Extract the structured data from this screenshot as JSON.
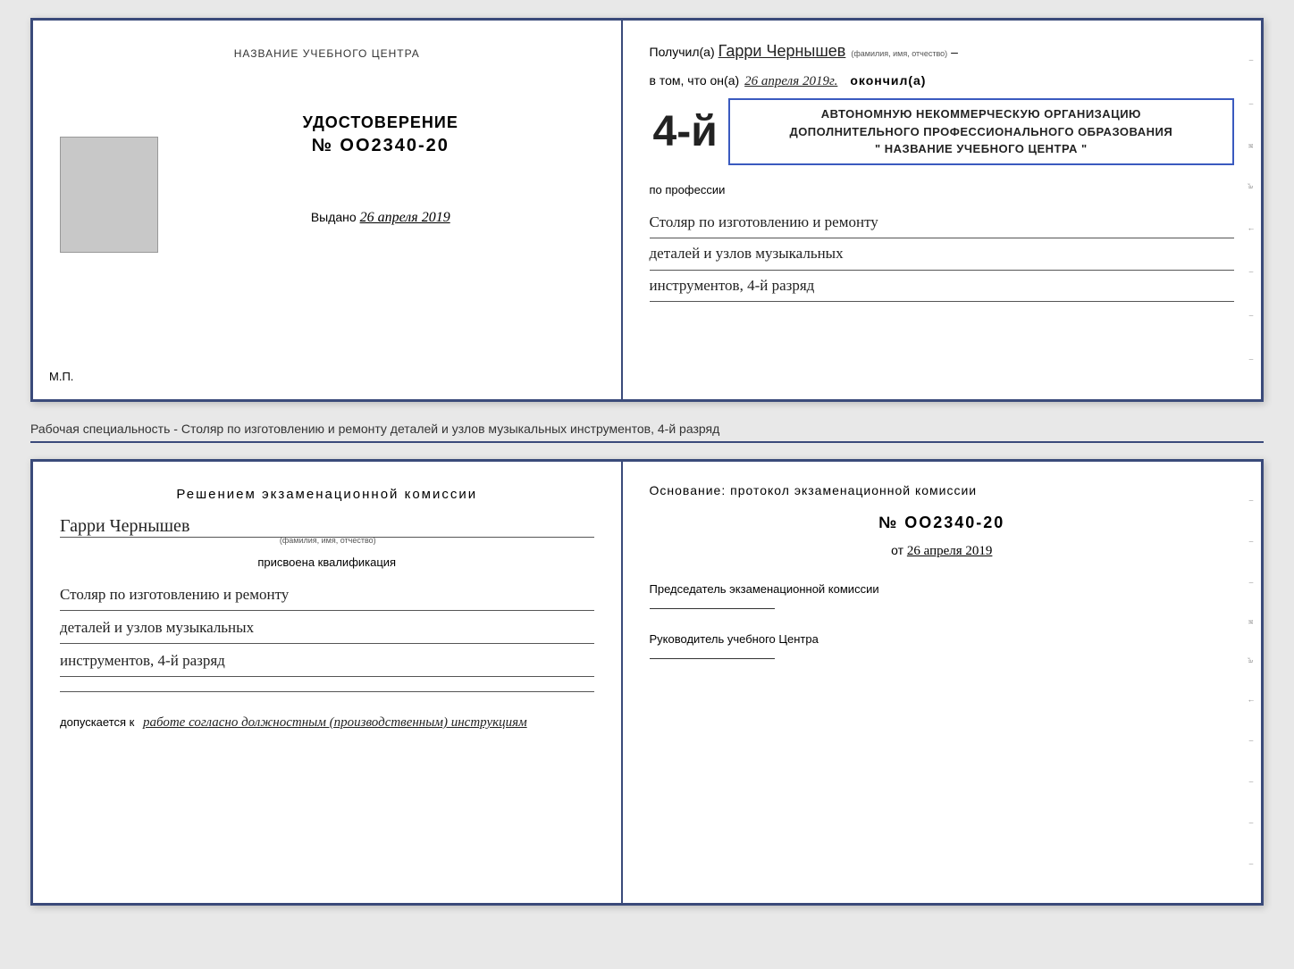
{
  "top_doc": {
    "left": {
      "org_name": "НАЗВАНИЕ УЧЕБНОГО ЦЕНТРА",
      "cert_title": "УДОСТОВЕРЕНИЕ",
      "cert_number": "№ OO2340-20",
      "issued_label": "Выдано",
      "issued_date": "26 апреля 2019",
      "mp_label": "М.П."
    },
    "right": {
      "received_label": "Получил(а)",
      "recipient_name": "Гарри Чернышев",
      "name_subtext": "(фамилия, имя, отчество)",
      "in_that_label": "в том, что он(а)",
      "date_completed": "26 апреля 2019г.",
      "finished_label": "окончил(а)",
      "year_big": "4-й",
      "org_line1": "АВТОНОМНУЮ НЕКОММЕРЧЕСКУЮ ОРГАНИЗАЦИЮ",
      "org_line2": "ДОПОЛНИТЕЛЬНОГО ПРОФЕССИОНАЛЬНОГО ОБРАЗОВАНИЯ",
      "org_line3": "\" НАЗВАНИЕ УЧЕБНОГО ЦЕНТРА \"",
      "profession_label": "по профессии",
      "profession_line1": "Столяр по изготовлению и ремонту",
      "profession_line2": "деталей и узлов музыкальных",
      "profession_line3": "инструментов, 4-й разряд"
    }
  },
  "middle_label": "Рабочая специальность - Столяр по изготовлению и ремонту деталей и узлов музыкальных инструментов, 4-й разряд",
  "bottom_doc": {
    "left": {
      "decision_title": "Решением  экзаменационной  комиссии",
      "person_name": "Гарри Чернышев",
      "name_subtext": "(фамилия, имя, отчество)",
      "assigned_label": "присвоена квалификация",
      "qual_line1": "Столяр по изготовлению и ремонту",
      "qual_line2": "деталей и узлов музыкальных",
      "qual_line3": "инструментов, 4-й разряд",
      "allowed_label": "допускается к",
      "allowed_value": "работе согласно должностным (производственным) инструкциям"
    },
    "right": {
      "basis_label": "Основание: протокол экзаменационной  комиссии",
      "protocol_number": "№  OO2340-20",
      "protocol_date_prefix": "от",
      "protocol_date": "26 апреля 2019",
      "chairman_label": "Председатель экзаменационной комиссии",
      "head_label": "Руководитель учебного Центра"
    }
  }
}
